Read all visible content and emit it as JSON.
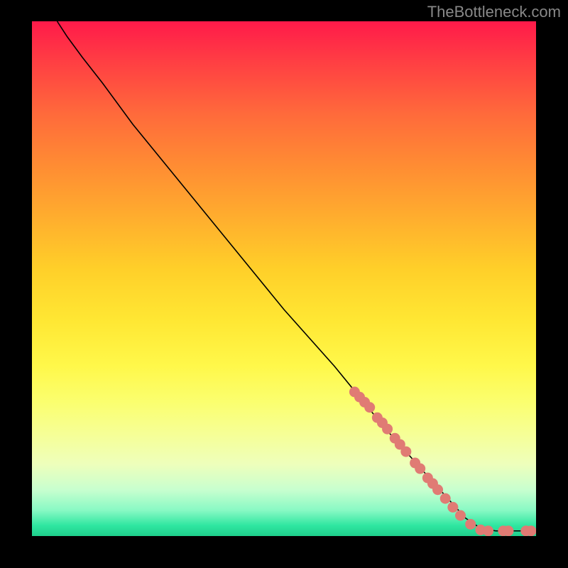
{
  "attribution": "TheBottleneck.com",
  "colors": {
    "marker": "#e07b74",
    "curve": "#000000",
    "background_outer": "#000000"
  },
  "chart_data": {
    "type": "line",
    "title": "",
    "xlabel": "",
    "ylabel": "",
    "xlim": [
      0,
      100
    ],
    "ylim": [
      0,
      100
    ],
    "series": [
      {
        "name": "curve",
        "points": [
          {
            "x": 5,
            "y": 100
          },
          {
            "x": 7,
            "y": 97
          },
          {
            "x": 10,
            "y": 93
          },
          {
            "x": 14,
            "y": 88
          },
          {
            "x": 20,
            "y": 80
          },
          {
            "x": 30,
            "y": 68
          },
          {
            "x": 40,
            "y": 56
          },
          {
            "x": 50,
            "y": 44
          },
          {
            "x": 60,
            "y": 33
          },
          {
            "x": 70,
            "y": 21
          },
          {
            "x": 80,
            "y": 10
          },
          {
            "x": 86,
            "y": 3.5
          },
          {
            "x": 89,
            "y": 1.5
          },
          {
            "x": 92,
            "y": 1
          },
          {
            "x": 96,
            "y": 1
          },
          {
            "x": 100,
            "y": 1
          }
        ]
      }
    ],
    "markers": [
      {
        "x": 64,
        "y": 28
      },
      {
        "x": 65,
        "y": 27
      },
      {
        "x": 66,
        "y": 26
      },
      {
        "x": 67,
        "y": 25
      },
      {
        "x": 68.5,
        "y": 23
      },
      {
        "x": 69.5,
        "y": 22
      },
      {
        "x": 70.5,
        "y": 20.8
      },
      {
        "x": 72,
        "y": 19
      },
      {
        "x": 73,
        "y": 17.8
      },
      {
        "x": 74.2,
        "y": 16.4
      },
      {
        "x": 76,
        "y": 14.2
      },
      {
        "x": 77,
        "y": 13.1
      },
      {
        "x": 78.5,
        "y": 11.3
      },
      {
        "x": 79.5,
        "y": 10.2
      },
      {
        "x": 80.5,
        "y": 9
      },
      {
        "x": 82,
        "y": 7.3
      },
      {
        "x": 83.5,
        "y": 5.6
      },
      {
        "x": 85,
        "y": 4
      },
      {
        "x": 87,
        "y": 2.3
      },
      {
        "x": 89,
        "y": 1.2
      },
      {
        "x": 90.5,
        "y": 1
      },
      {
        "x": 93.5,
        "y": 1
      },
      {
        "x": 94.5,
        "y": 1
      },
      {
        "x": 98,
        "y": 1
      },
      {
        "x": 99,
        "y": 1
      }
    ],
    "gradient_note": "vertical red-to-green heat gradient background"
  }
}
